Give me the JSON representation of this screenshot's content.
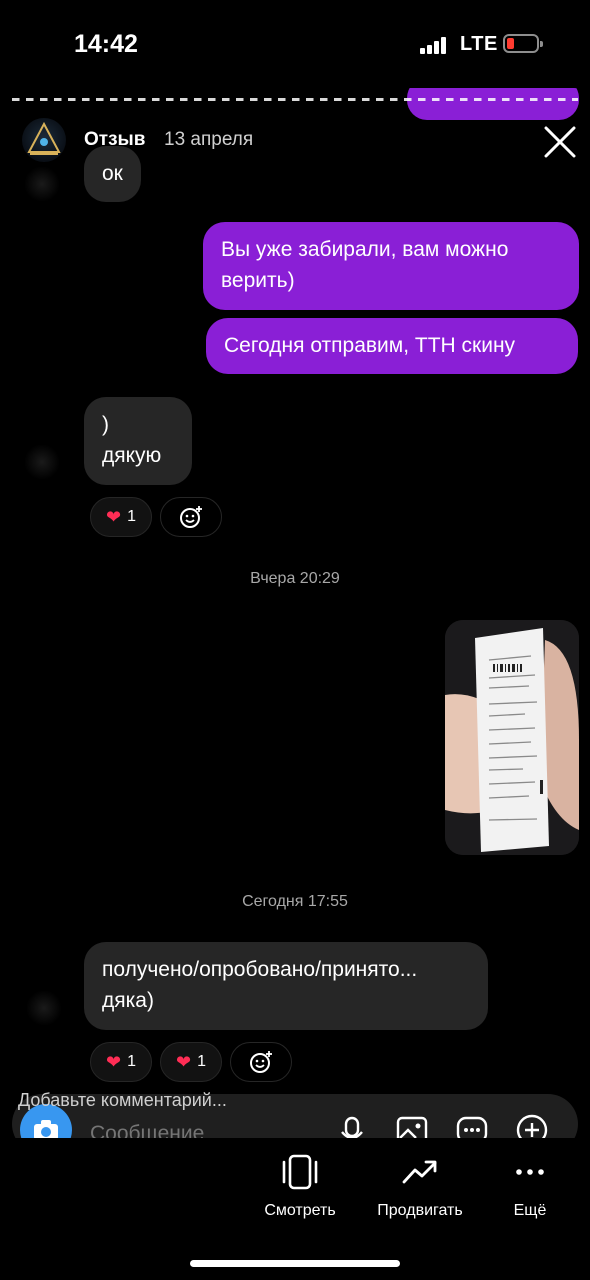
{
  "status_bar": {
    "time": "14:42",
    "network": "LTE"
  },
  "story": {
    "username": "Отзыв",
    "date": "13 апреля"
  },
  "chat": {
    "messages": [
      {
        "side": "in",
        "text": "ок"
      },
      {
        "side": "out",
        "lines": [
          "Вы уже забирали, вам можно",
          "верить)"
        ]
      },
      {
        "side": "out",
        "lines": [
          "Сегодня отправим, ТТН скину"
        ]
      },
      {
        "side": "in",
        "lines": [
          ")",
          "дякую"
        ]
      },
      {
        "side": "in",
        "lines": [
          "получено/опробовано/принято...",
          "дяка)"
        ]
      }
    ],
    "reaction_count_1": "1",
    "reaction_count_2": "1",
    "reaction_count_3": "1",
    "timestamp_1": "Вчера 20:29",
    "timestamp_2": "Сегодня 17:55"
  },
  "composer": {
    "comment_label": "Добавьте комментарий...",
    "placeholder": "Сообщение"
  },
  "bottom_bar": {
    "watch": "Смотреть",
    "promote": "Продвигать",
    "more": "Ещё"
  },
  "colors": {
    "outgoing_bubble": "#8a1fd6",
    "incoming_bubble": "#262626",
    "camera_button": "#3897f0"
  }
}
